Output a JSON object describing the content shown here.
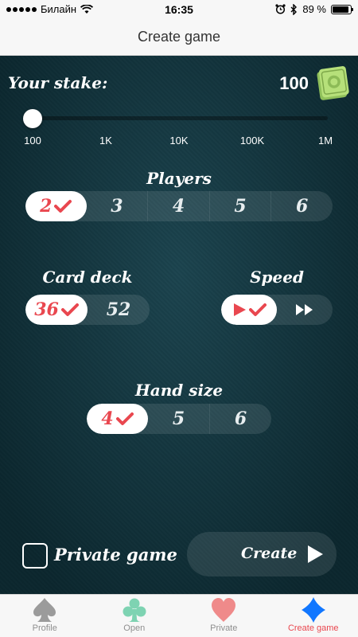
{
  "status": {
    "carrier": "Билайн",
    "time": "16:35",
    "battery": "89 %",
    "battery_level": 0.89
  },
  "nav": {
    "title": "Create game"
  },
  "stake": {
    "label": "Your stake:",
    "value": "100",
    "ticks": [
      "100",
      "1K",
      "10K",
      "100K",
      "1M"
    ],
    "selected_index": 0
  },
  "players": {
    "title": "Players",
    "options": [
      "2",
      "3",
      "4",
      "5",
      "6"
    ],
    "selected": "2"
  },
  "deck": {
    "title": "Card deck",
    "options": [
      "36",
      "52"
    ],
    "selected": "36"
  },
  "speed": {
    "title": "Speed",
    "options": [
      "play-icon",
      "fast-forward-icon"
    ],
    "selected": "play-icon"
  },
  "hand": {
    "title": "Hand size",
    "options": [
      "4",
      "5",
      "6"
    ],
    "selected": "4"
  },
  "private_game": {
    "label": "Private game",
    "checked": false
  },
  "create": {
    "label": "Create"
  },
  "tabs": [
    {
      "label": "Profile",
      "icon": "spade-icon",
      "color": "#9b9b9b",
      "active": false
    },
    {
      "label": "Open",
      "icon": "club-icon",
      "color": "#7ed3b2",
      "active": false
    },
    {
      "label": "Private",
      "icon": "heart-icon",
      "color": "#ef8a8a",
      "active": false
    },
    {
      "label": "Create game",
      "icon": "diamond-icon",
      "color": "#1177ff",
      "active": true
    }
  ],
  "colors": {
    "felt": "#123c47",
    "accent": "#e9474f",
    "active_tab": "#1177ff"
  }
}
